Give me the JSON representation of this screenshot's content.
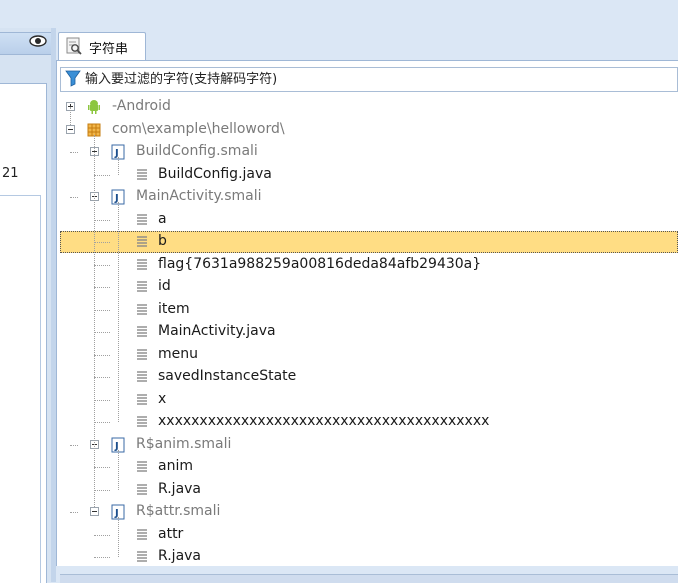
{
  "left_pane": {
    "visible_number": "21"
  },
  "tab": {
    "label": "字符串",
    "icon": "string-search-icon"
  },
  "filter": {
    "placeholder": "输入要过滤的字符(支持解码字符)",
    "icon": "funnel-filter-icon"
  },
  "tree": {
    "rows": [
      {
        "label": "-Android",
        "level": 0,
        "type": "android",
        "expander": "plus",
        "gray": true
      },
      {
        "label": "com\\example\\helloword\\",
        "level": 0,
        "type": "package",
        "expander": "minus",
        "gray": true
      },
      {
        "label": "BuildConfig.smali",
        "level": 1,
        "type": "smali",
        "expander": "minus",
        "gray": true
      },
      {
        "label": "BuildConfig.java",
        "level": 2,
        "type": "string",
        "gray": false
      },
      {
        "label": "MainActivity.smali",
        "level": 1,
        "type": "smali",
        "expander": "minus",
        "gray": true
      },
      {
        "label": "a",
        "level": 2,
        "type": "string",
        "gray": false
      },
      {
        "label": "b",
        "level": 2,
        "type": "string",
        "gray": false,
        "selected": true
      },
      {
        "label": "flag{7631a988259a00816deda84afb29430a}",
        "level": 2,
        "type": "string",
        "gray": false
      },
      {
        "label": "id",
        "level": 2,
        "type": "string",
        "gray": false
      },
      {
        "label": "item",
        "level": 2,
        "type": "string",
        "gray": false
      },
      {
        "label": "MainActivity.java",
        "level": 2,
        "type": "string",
        "gray": false
      },
      {
        "label": "menu",
        "level": 2,
        "type": "string",
        "gray": false
      },
      {
        "label": "savedInstanceState",
        "level": 2,
        "type": "string",
        "gray": false
      },
      {
        "label": "x",
        "level": 2,
        "type": "string",
        "gray": false
      },
      {
        "label": "xxxxxxxxxxxxxxxxxxxxxxxxxxxxxxxxxxxxxxxx",
        "level": 2,
        "type": "string",
        "gray": false
      },
      {
        "label": "R$anim.smali",
        "level": 1,
        "type": "smali",
        "expander": "minus",
        "gray": true
      },
      {
        "label": "anim",
        "level": 2,
        "type": "string",
        "gray": false
      },
      {
        "label": "R.java",
        "level": 2,
        "type": "string",
        "gray": false
      },
      {
        "label": "R$attr.smali",
        "level": 1,
        "type": "smali",
        "expander": "minus",
        "gray": true
      },
      {
        "label": "attr",
        "level": 2,
        "type": "string",
        "gray": false
      },
      {
        "label": "R.java",
        "level": 2,
        "type": "string",
        "gray": false
      }
    ]
  },
  "colors": {
    "selected_row": "#ffdd84",
    "frame": "#dbe7f5",
    "gray_text": "#7a7a7a"
  }
}
